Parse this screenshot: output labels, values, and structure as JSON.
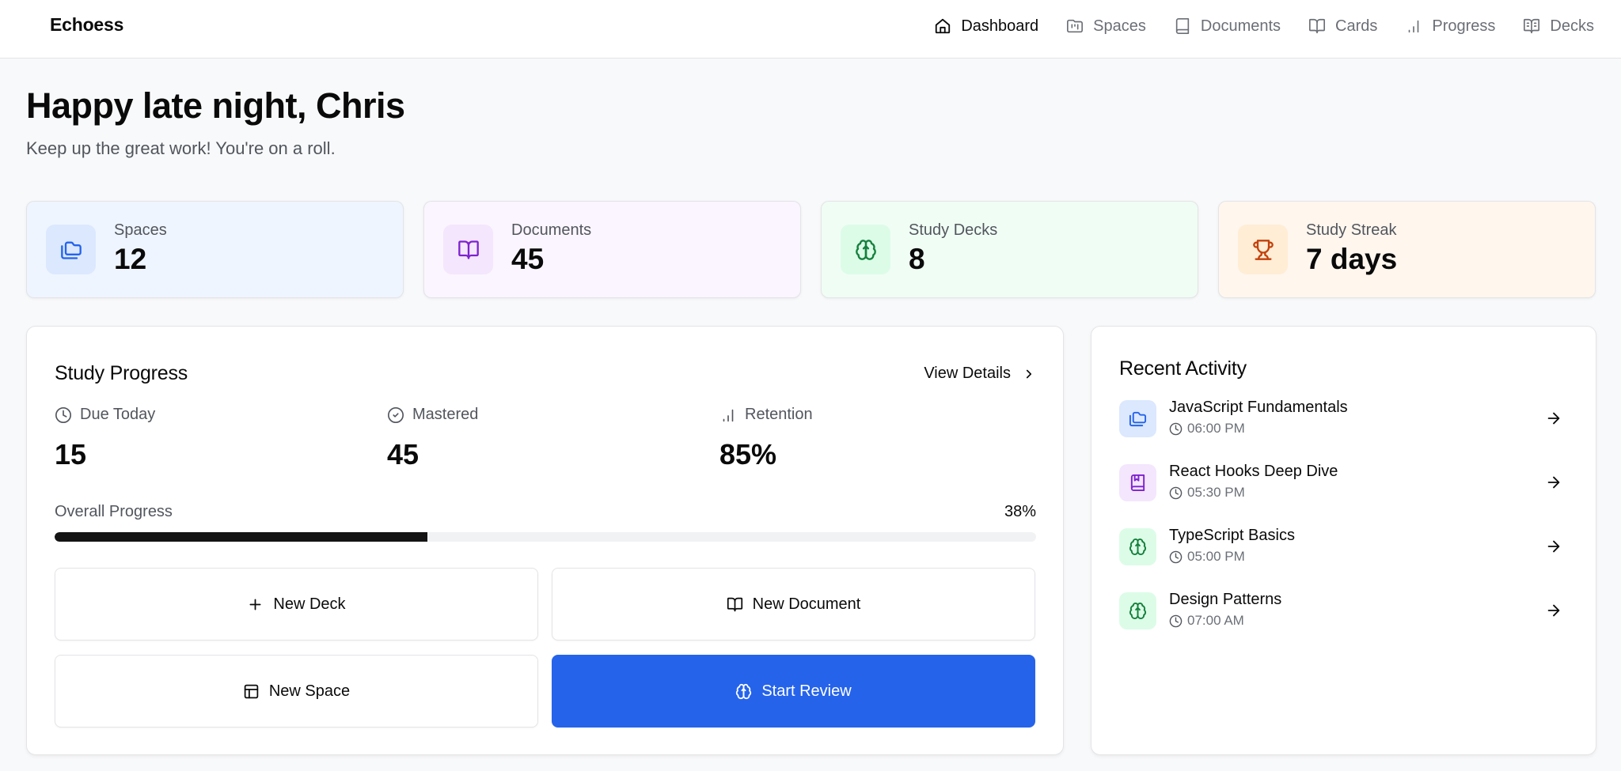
{
  "app": {
    "brand": "Echoess"
  },
  "nav": {
    "items": [
      {
        "label": "Dashboard",
        "icon": "home-icon",
        "active": true
      },
      {
        "label": "Spaces",
        "icon": "folder-kanban-icon",
        "active": false
      },
      {
        "label": "Documents",
        "icon": "book-icon",
        "active": false
      },
      {
        "label": "Cards",
        "icon": "book-open-icon",
        "active": false
      },
      {
        "label": "Progress",
        "icon": "bar-chart-icon",
        "active": false
      },
      {
        "label": "Decks",
        "icon": "book-open-text-icon",
        "active": false
      }
    ]
  },
  "greeting": {
    "title": "Happy late night, Chris",
    "subtitle": "Keep up the great work! You're on a roll."
  },
  "stats": [
    {
      "label": "Spaces",
      "value": "12",
      "icon": "folders-icon",
      "bg": "#eff5ff",
      "icon_bg": "#dbe8fe",
      "icon_color": "#2563eb"
    },
    {
      "label": "Documents",
      "value": "45",
      "icon": "book-open-icon",
      "bg": "#fbf5ff",
      "icon_bg": "#f3e6fd",
      "icon_color": "#7e22ce"
    },
    {
      "label": "Study Decks",
      "value": "8",
      "icon": "brain-icon",
      "bg": "#f0fdf4",
      "icon_bg": "#dcfce7",
      "icon_color": "#15803d"
    },
    {
      "label": "Study Streak",
      "value": "7 days",
      "icon": "trophy-icon",
      "bg": "#fff6ee",
      "icon_bg": "#ffedd5",
      "icon_color": "#c2410c"
    }
  ],
  "study_progress": {
    "title": "Study Progress",
    "view_details_label": "View Details",
    "metrics": [
      {
        "label": "Due Today",
        "value": "15",
        "icon": "clock-icon"
      },
      {
        "label": "Mastered",
        "value": "45",
        "icon": "check-circle-icon"
      },
      {
        "label": "Retention",
        "value": "85%",
        "icon": "bar-chart-icon"
      }
    ],
    "overall_label": "Overall Progress",
    "overall_value_text": "38%",
    "overall_percent": 38,
    "actions": [
      {
        "label": "New Deck",
        "icon": "plus-icon",
        "primary": false
      },
      {
        "label": "New Document",
        "icon": "book-open-icon",
        "primary": false
      },
      {
        "label": "New Space",
        "icon": "layout-icon",
        "primary": false
      },
      {
        "label": "Start Review",
        "icon": "brain-icon",
        "primary": true
      }
    ]
  },
  "recent_activity": {
    "title": "Recent Activity",
    "items": [
      {
        "title": "JavaScript Fundamentals",
        "time": "06:00 PM",
        "icon": "folders-icon",
        "icon_bg": "#dbe8fe",
        "icon_color": "#2563eb"
      },
      {
        "title": "React Hooks Deep Dive",
        "time": "05:30 PM",
        "icon": "bookmark-book-icon",
        "icon_bg": "#f3e6fd",
        "icon_color": "#7e22ce"
      },
      {
        "title": "TypeScript Basics",
        "time": "05:00 PM",
        "icon": "brain-icon",
        "icon_bg": "#dcfce7",
        "icon_color": "#15803d"
      },
      {
        "title": "Design Patterns",
        "time": "07:00 AM",
        "icon": "brain-icon",
        "icon_bg": "#dcfce7",
        "icon_color": "#15803d"
      }
    ]
  },
  "colors": {
    "primary": "#2563eb",
    "progress_fill": "#141414",
    "progress_track": "#f1f2f3"
  }
}
